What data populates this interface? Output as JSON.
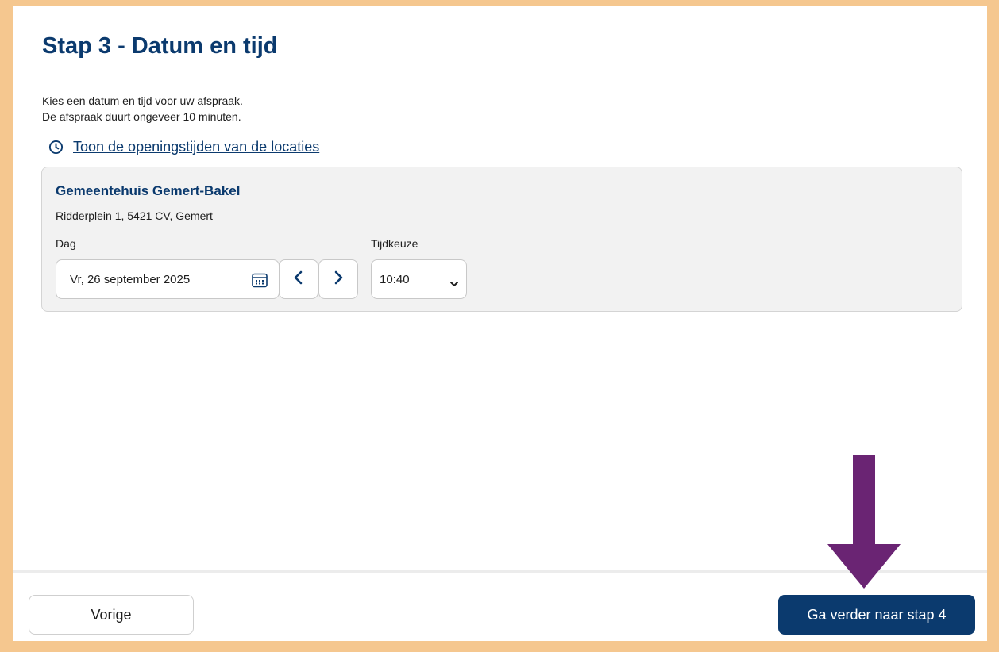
{
  "page": {
    "title": "Stap 3 - Datum en tijd",
    "intro_line1": "Kies een datum en tijd voor uw afspraak.",
    "intro_line2": "De afspraak duurt ongeveer 10 minuten.",
    "hours_link": "Toon de openingstijden van de locaties"
  },
  "location": {
    "name": "Gemeentehuis Gemert-Bakel",
    "address": "Ridderplein 1, 5421 CV, Gemert",
    "day_label": "Dag",
    "time_label": "Tijdkeuze",
    "date_value": "Vr, 26 september 2025",
    "time_value": "10:40"
  },
  "footer": {
    "prev_label": "Vorige",
    "next_label": "Ga verder naar stap 4"
  },
  "colors": {
    "brand_blue": "#0b3a6e",
    "frame_orange": "#f5c78f",
    "arrow_purple": "#6a2473"
  },
  "icons": {
    "hours": "clock-icon",
    "date": "calendar-icon",
    "prev_day": "chevron-left-icon",
    "next_day": "chevron-right-icon",
    "time": "chevron-down-icon",
    "annotation": "arrow-down-icon"
  }
}
